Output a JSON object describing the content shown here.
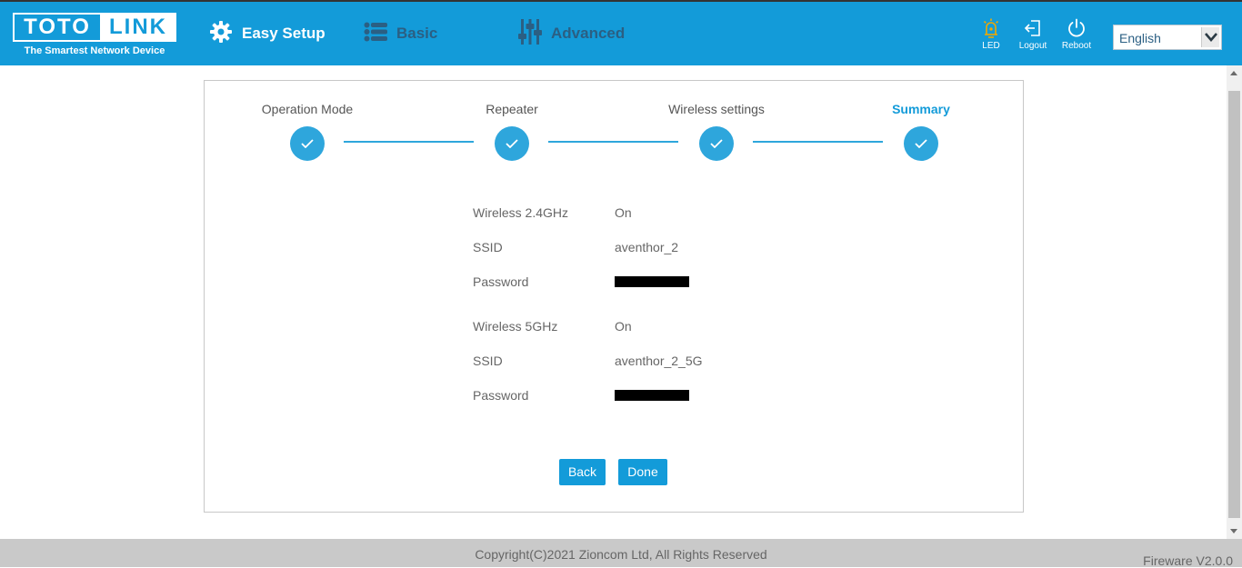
{
  "brand": {
    "logo_left": "TOTO",
    "logo_right": "LINK",
    "tagline": "The Smartest Network Device"
  },
  "nav": {
    "easy_setup": "Easy Setup",
    "basic": "Basic",
    "advanced": "Advanced"
  },
  "tools": {
    "led": "LED",
    "logout": "Logout",
    "reboot": "Reboot"
  },
  "language": {
    "selected": "English"
  },
  "steps": [
    {
      "label": "Operation Mode",
      "done": true
    },
    {
      "label": "Repeater",
      "done": true
    },
    {
      "label": "Wireless settings",
      "done": true
    },
    {
      "label": "Summary",
      "done": true,
      "active": true
    }
  ],
  "summary": {
    "wifi24": {
      "label": "Wireless 2.4GHz",
      "value": "On"
    },
    "ssid24": {
      "label": "SSID",
      "value": "aventhor_2"
    },
    "pass24": {
      "label": "Password"
    },
    "wifi5": {
      "label": "Wireless 5GHz",
      "value": "On"
    },
    "ssid5": {
      "label": "SSID",
      "value": "aventhor_2_5G"
    },
    "pass5": {
      "label": "Password"
    }
  },
  "buttons": {
    "back": "Back",
    "done": "Done"
  },
  "footer": {
    "copyright": "Copyright(C)2021 Zioncom Ltd, All Rights Reserved",
    "version": "Fireware V2.0.0"
  },
  "colors": {
    "primary": "#139bd9",
    "step": "#2ea6dc",
    "nav_inactive": "#2b5f83",
    "led_icon": "#f0a800"
  }
}
